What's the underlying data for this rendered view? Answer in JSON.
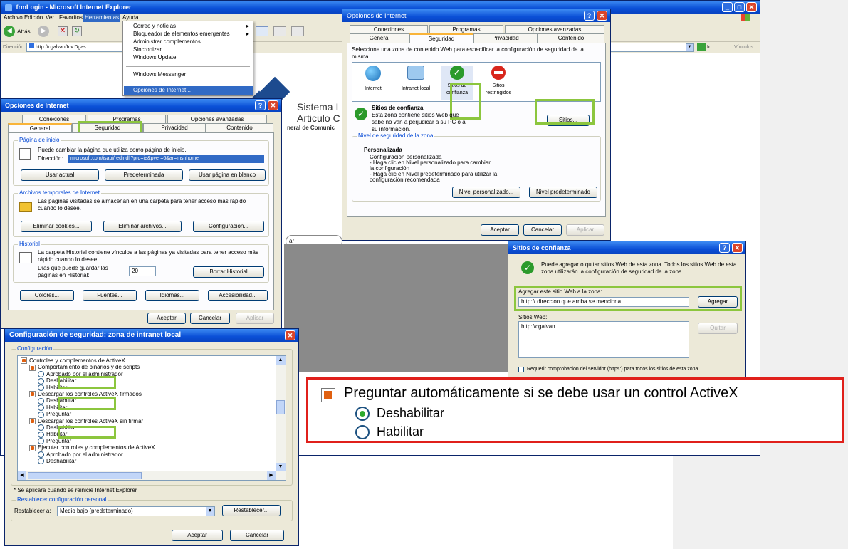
{
  "ie": {
    "title": "frmLogin - Microsoft Internet Explorer",
    "menu": [
      "Archivo",
      "Edición",
      "Ver",
      "Favoritos",
      "Herramientas",
      "Ayuda"
    ],
    "back": "Atrás",
    "address_label": "Dirección",
    "address_value": "http://cgalvan/Inv.Dgas...",
    "go": "Ir",
    "links": "Vínculos"
  },
  "tools_menu": {
    "items": [
      "Correo y noticias",
      "Bloqueador de elementos emergentes",
      "Administrar complementos...",
      "Sincronizar...",
      "Windows Update",
      "Windows Messenger",
      "Opciones de Internet..."
    ]
  },
  "bg_page": {
    "line1": "Sistema I",
    "line2": "Articulo C",
    "line3": "neral de Comunic",
    "button": "ar"
  },
  "dlg_general": {
    "title": "Opciones de Internet",
    "tabs_top": [
      "Conexiones",
      "Programas",
      "Opciones avanzadas"
    ],
    "tabs_bottom": [
      "General",
      "Seguridad",
      "Privacidad",
      "Contenido"
    ],
    "home_group": "Página de inicio",
    "home_desc": "Puede cambiar la página que utiliza como página de inicio.",
    "home_label": "Dirección:",
    "home_value": "microsoft.com/isapi/redir.dll?prd=ie&pver=6&ar=msnhome",
    "btn_current": "Usar actual",
    "btn_default": "Predeterminada",
    "btn_blank": "Usar página en blanco",
    "temp_group": "Archivos temporales de Internet",
    "temp_desc": "Las páginas visitadas se almacenan en una carpeta para tener acceso más rápido cuando lo desee.",
    "btn_cookies": "Eliminar cookies...",
    "btn_files": "Eliminar archivos...",
    "btn_config": "Configuración...",
    "hist_group": "Historial",
    "hist_desc": "La carpeta Historial contiene vínculos a las páginas ya visitadas para tener acceso más rápido cuando lo desee.",
    "hist_days_label": "Días que puede guardar las páginas en Historial:",
    "hist_days": "20",
    "btn_clear_hist": "Borrar Historial",
    "btn_colors": "Colores...",
    "btn_fonts": "Fuentes...",
    "btn_langs": "Idiomas...",
    "btn_access": "Accesibilidad...",
    "ok": "Aceptar",
    "cancel": "Cancelar",
    "apply": "Aplicar"
  },
  "dlg_security": {
    "title": "Opciones de Internet",
    "tabs_top": [
      "Conexiones",
      "Programas",
      "Opciones avanzadas"
    ],
    "tabs_bottom": [
      "General",
      "Seguridad",
      "Privacidad",
      "Contenido"
    ],
    "instruction": "Seleccione una zona de contenido Web para especificar la configuración de seguridad de la misma.",
    "zones": [
      "Internet",
      "Intranet local",
      "Sitios de confianza",
      "Sitios restringidos"
    ],
    "zone_title": "Sitios de confianza",
    "zone_desc": "Esta zona contiene sitios Web que sabe no van a perjudicar a su PC o a su información.",
    "sites_btn": "Sitios...",
    "level_group": "Nivel de seguridad de la zona",
    "level_title": "Personalizada",
    "level_lines": [
      "Configuración personalizada",
      "- Haga clic en Nivel personalizado para cambiar",
      "  la configuración",
      "- Haga clic en Nivel predeterminado para utilizar la",
      "  configuración recomendada"
    ],
    "btn_custom": "Nivel personalizado...",
    "btn_default_level": "Nivel predeterminado",
    "ok": "Aceptar",
    "cancel": "Cancelar",
    "apply": "Aplicar"
  },
  "dlg_trusted": {
    "title": "Sitios de confianza",
    "desc": "Puede agregar o quitar sitios Web de esta zona.  Todos los sitios Web de esta zona utilizarán la configuración de seguridad de la zona.",
    "add_label": "Agregar este sitio Web a la zona:",
    "add_value": "http:// direccion que arriba se menciona",
    "add_btn": "Agregar",
    "list_label": "Sitios Web:",
    "list_items": [
      "http://cgalvan"
    ],
    "remove_btn": "Quitar",
    "require_https": "Requerir comprobación del servidor (https:) para todos los sitios de esta zona"
  },
  "dlg_config": {
    "title": "Configuración de seguridad: zona de intranet local",
    "group": "Configuración",
    "tree": [
      {
        "kind": "heading",
        "text": "Controles y complementos de ActiveX",
        "indent": 0
      },
      {
        "kind": "heading",
        "text": "Comportamiento de binarios y de scripts",
        "indent": 1
      },
      {
        "kind": "radio",
        "text": "Aprobado por el administrador",
        "indent": 2
      },
      {
        "kind": "radio",
        "text": "Deshabilitar",
        "indent": 2
      },
      {
        "kind": "radio",
        "text": "Habilitar",
        "indent": 2
      },
      {
        "kind": "heading",
        "text": "Descargar los controles ActiveX firmados",
        "indent": 1
      },
      {
        "kind": "radio",
        "text": "Deshabilitar",
        "indent": 2
      },
      {
        "kind": "radio",
        "text": "Habilitar",
        "indent": 2
      },
      {
        "kind": "radio",
        "text": "Preguntar",
        "indent": 2
      },
      {
        "kind": "heading",
        "text": "Descargar los controles ActiveX sin firmar",
        "indent": 1
      },
      {
        "kind": "radio",
        "text": "Deshabilitar",
        "indent": 2
      },
      {
        "kind": "radio",
        "text": "Habilitar",
        "indent": 2
      },
      {
        "kind": "radio",
        "text": "Preguntar",
        "indent": 2
      },
      {
        "kind": "heading",
        "text": "Ejecutar controles y complementos de ActiveX",
        "indent": 1
      },
      {
        "kind": "radio",
        "text": "Aprobado por el administrador",
        "indent": 2
      },
      {
        "kind": "radio",
        "text": "Deshabilitar",
        "indent": 2
      }
    ],
    "note": "* Se aplicará cuando se reinicie Internet Explorer",
    "reset_group": "Restablecer configuración personal",
    "reset_label": "Restablecer a:",
    "reset_value": "Medio bajo (predeterminado)",
    "reset_btn": "Restablecer...",
    "ok": "Aceptar",
    "cancel": "Cancelar"
  },
  "callout": {
    "heading": "Preguntar automáticamente si se debe usar un control ActiveX",
    "option1": "Deshabilitar",
    "option2": "Habilitar"
  },
  "colors": {
    "xp_blue": "#0a4fd6",
    "highlight_green": "#8cc63e",
    "callout_red": "#e0201b",
    "dialog_bg": "#ece9d8",
    "right_gray": "#f0f0f0"
  }
}
